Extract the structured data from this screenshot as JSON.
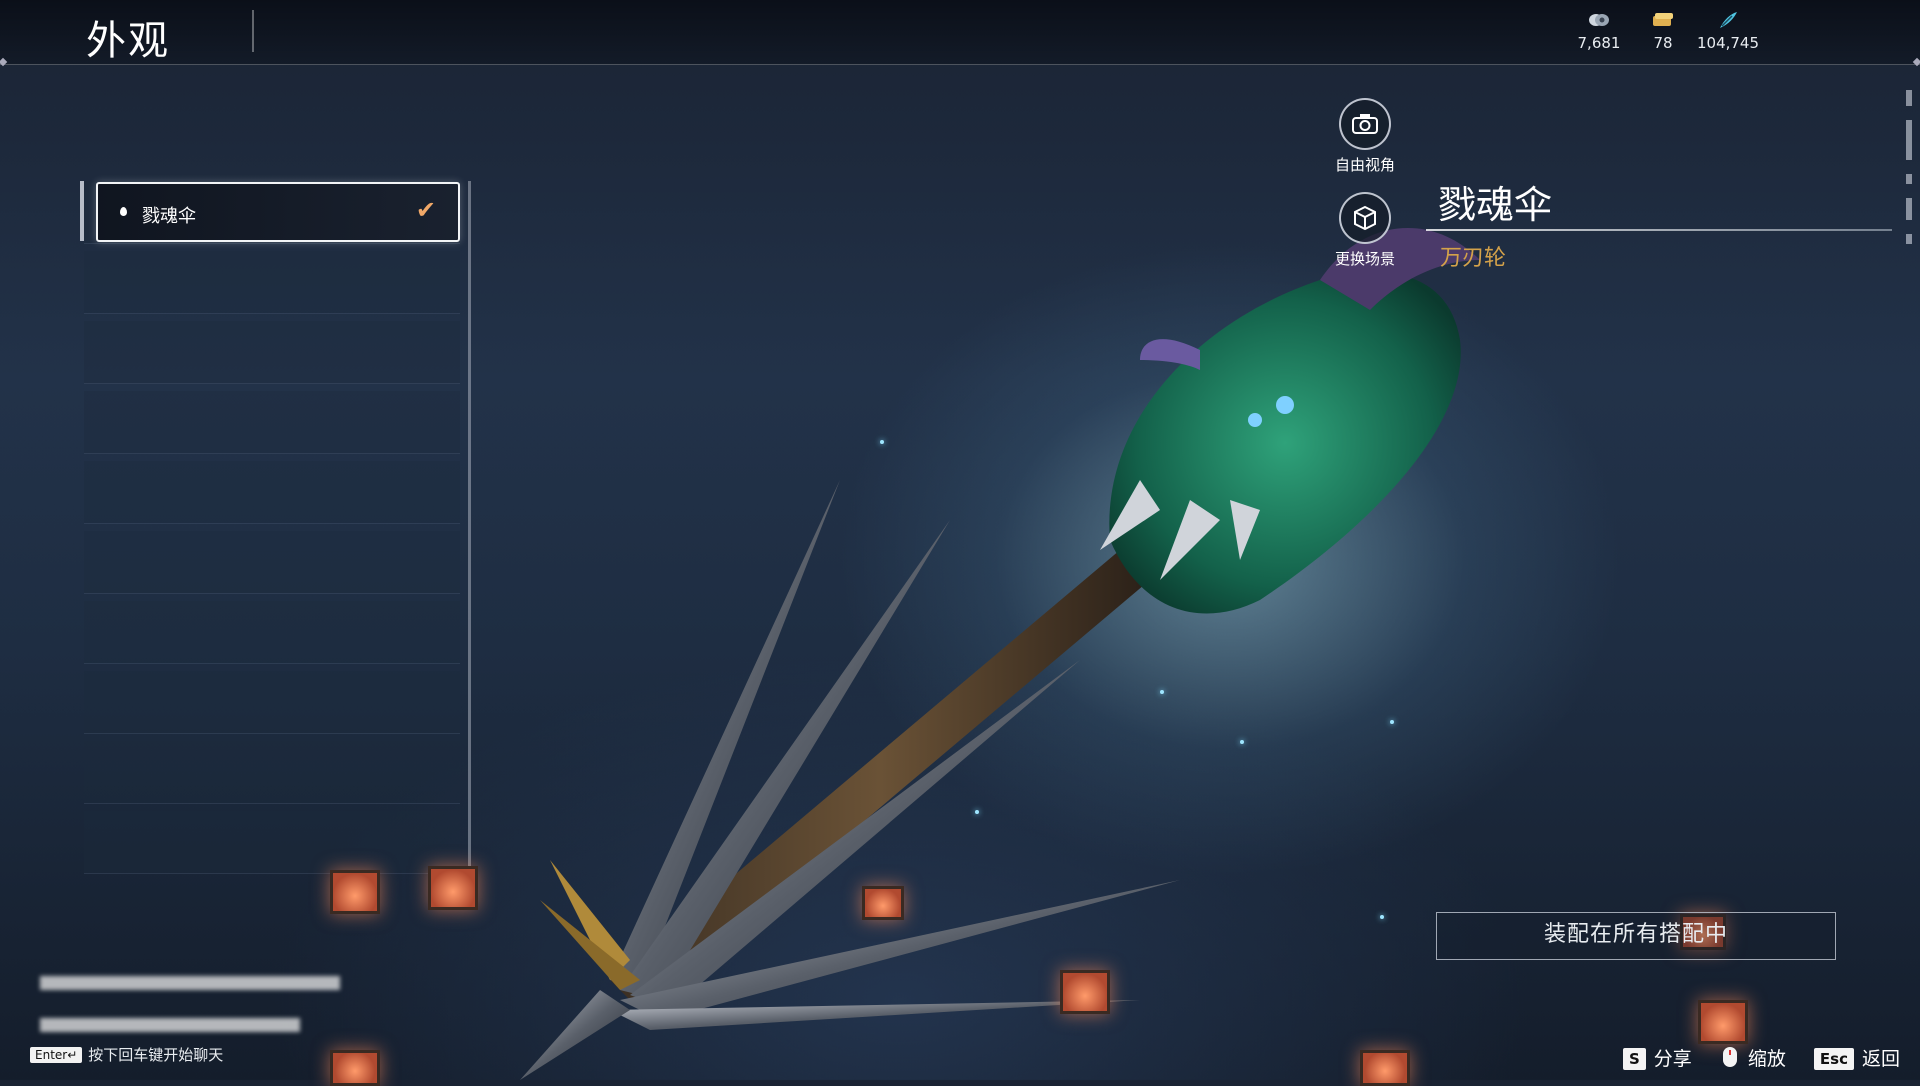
{
  "header": {
    "title": "外观"
  },
  "currencies": [
    {
      "icon": "coin-stack-icon",
      "value": "7,681"
    },
    {
      "icon": "gold-ticket-icon",
      "value": "78"
    },
    {
      "icon": "feather-gem-icon",
      "value": "104,745"
    }
  ],
  "appearance_list": {
    "selected_item": {
      "name": "戮魂伞",
      "equipped": true
    },
    "empty_slots": 9
  },
  "side_buttons": {
    "free_camera": "自由视角",
    "change_scene": "更换场景"
  },
  "weapon": {
    "name": "戮魂伞",
    "type": "万刃轮"
  },
  "equip_button": "装配在所有搭配中",
  "chat": {
    "key": "Enter↵",
    "hint": "按下回车键开始聊天"
  },
  "bottom_actions": [
    {
      "key": "S",
      "label": "分享"
    },
    {
      "key": "",
      "label": "缩放"
    },
    {
      "key": "Esc",
      "label": "返回"
    }
  ],
  "colors": {
    "accent_gold": "#d4a24a",
    "check_orange": "#f0a868"
  }
}
